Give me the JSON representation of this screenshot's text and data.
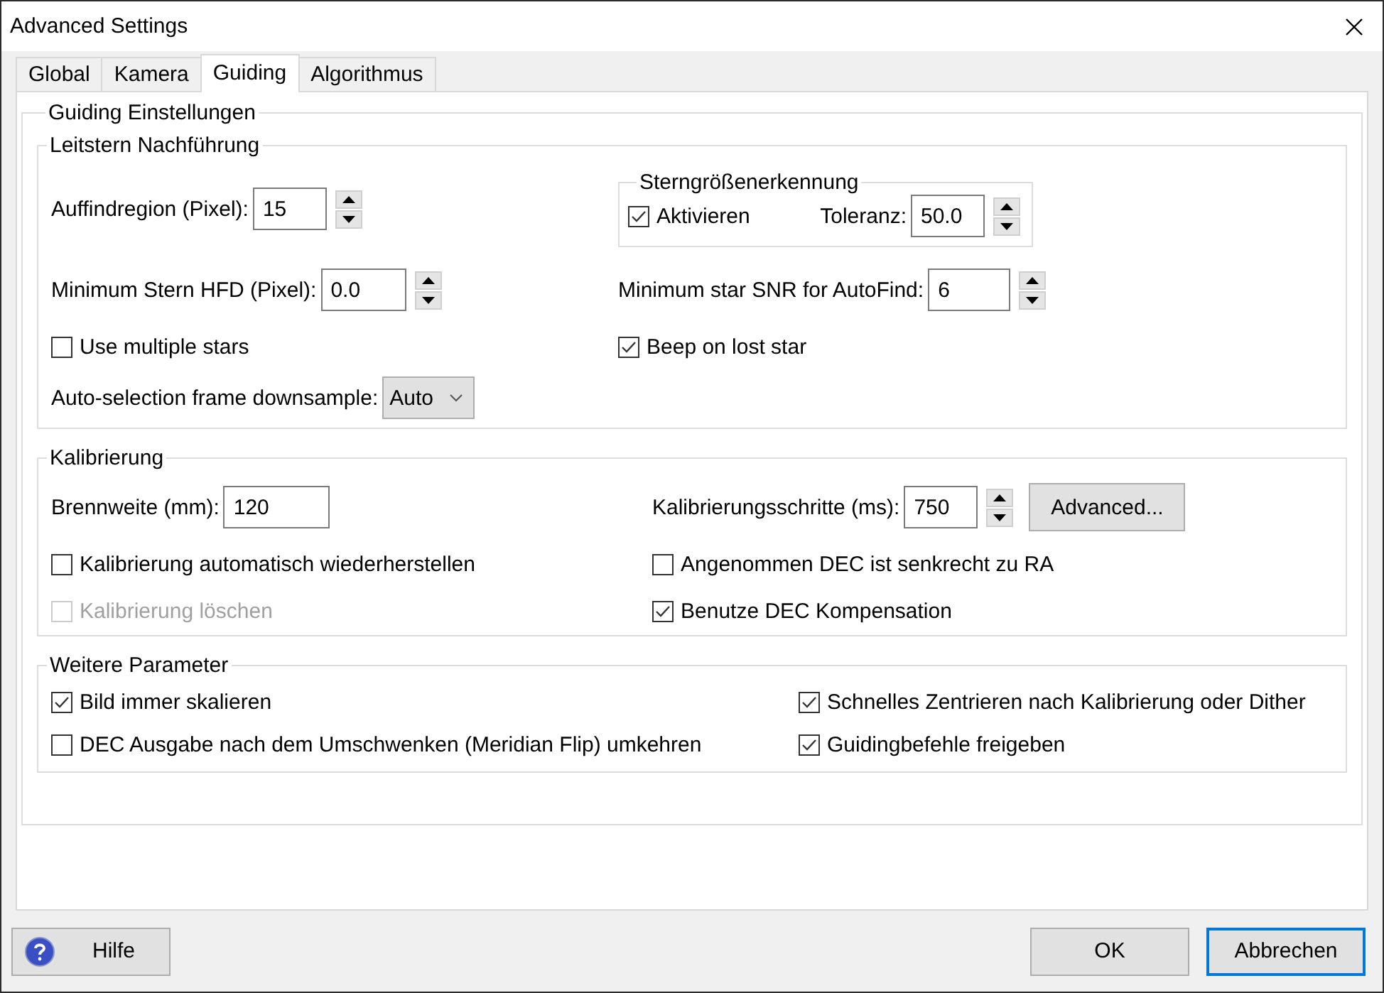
{
  "window": {
    "title": "Advanced Settings"
  },
  "tabs": [
    {
      "label": "Global",
      "selected": false
    },
    {
      "label": "Kamera",
      "selected": false
    },
    {
      "label": "Guiding",
      "selected": true
    },
    {
      "label": "Algorithmus",
      "selected": false
    }
  ],
  "guiding": {
    "title": "Guiding Einstellungen",
    "star_tracking": {
      "title": "Leitstern  Nachführung",
      "search_region": {
        "label": "Auffindregion (Pixel):",
        "value": "15"
      },
      "star_mass": {
        "title": "Sterngrößenerkennung",
        "enable": {
          "label": "Aktivieren",
          "checked": true
        },
        "tolerance": {
          "label": "Toleranz:",
          "value": "50.0"
        }
      },
      "min_hfd": {
        "label": "Minimum Stern HFD (Pixel):",
        "value": "0.0"
      },
      "min_snr": {
        "label": "Minimum star SNR for AutoFind:",
        "value": "6"
      },
      "multiple_stars": {
        "label": "Use multiple stars",
        "checked": false
      },
      "beep": {
        "label": "Beep on lost star",
        "checked": true
      },
      "downsample": {
        "label": "Auto-selection frame downsample:",
        "value": "Auto"
      }
    },
    "calibration": {
      "title": "Kalibrierung",
      "focal_length": {
        "label": "Brennweite (mm):",
        "value": "120"
      },
      "step": {
        "label": "Kalibrierungsschritte (ms):",
        "value": "750"
      },
      "advanced_button": "Advanced...",
      "left": [
        {
          "label": "Kalibrierung automatisch wiederherstellen",
          "checked": false,
          "disabled": false
        },
        {
          "label": "Kalibrierung löschen",
          "checked": false,
          "disabled": true
        }
      ],
      "right": [
        {
          "label": "Angenommen DEC ist senkrecht zu RA",
          "checked": false,
          "disabled": false
        },
        {
          "label": "Benutze DEC Kompensation",
          "checked": true,
          "disabled": false
        }
      ]
    },
    "more": {
      "title": "Weitere Parameter",
      "left": [
        {
          "label": "Bild immer skalieren",
          "checked": true,
          "disabled": false
        },
        {
          "label": "DEC Ausgabe nach dem Umschwenken (Meridian Flip) umkehren",
          "checked": false,
          "disabled": false
        }
      ],
      "right": [
        {
          "label": "Schnelles Zentrieren nach Kalibrierung oder Dither",
          "checked": true,
          "disabled": false
        },
        {
          "label": "Guidingbefehle freigeben",
          "checked": true,
          "disabled": false
        }
      ]
    }
  },
  "buttons": {
    "help": "Hilfe",
    "ok": {
      "label": "OK",
      "focused": false
    },
    "cancel": {
      "label": "Abbrechen",
      "focused": true
    }
  }
}
